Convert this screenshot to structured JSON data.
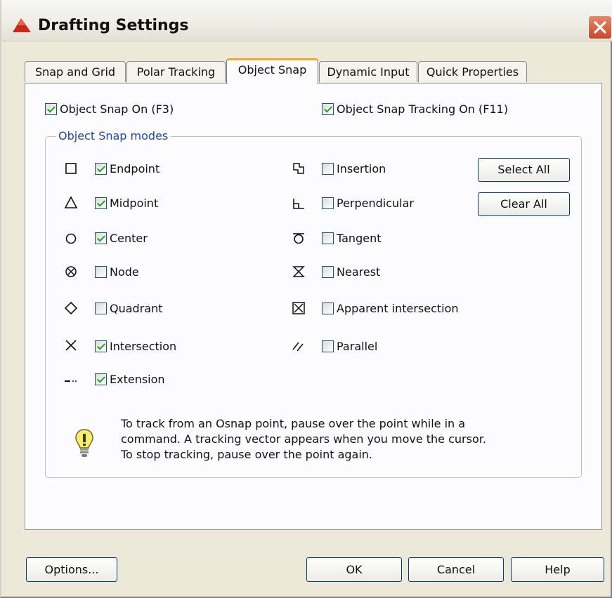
{
  "window": {
    "title": "Drafting Settings"
  },
  "tabs": [
    {
      "label": "Snap and Grid",
      "active": false
    },
    {
      "label": "Polar Tracking",
      "active": false
    },
    {
      "label": "Object Snap",
      "active": true
    },
    {
      "label": "Dynamic Input",
      "active": false
    },
    {
      "label": "Quick Properties",
      "active": false
    }
  ],
  "object_snap_on": {
    "label": "Object Snap On (F3)",
    "checked": true
  },
  "object_snap_tracking_on": {
    "label": "Object Snap Tracking On (F11)",
    "checked": true
  },
  "modes_group": {
    "label": "Object Snap modes"
  },
  "modes_left": [
    {
      "label": "Endpoint",
      "checked": true,
      "icon": "endpoint-icon"
    },
    {
      "label": "Midpoint",
      "checked": true,
      "icon": "midpoint-icon"
    },
    {
      "label": "Center",
      "checked": true,
      "icon": "center-icon"
    },
    {
      "label": "Node",
      "checked": false,
      "icon": "node-icon"
    },
    {
      "label": "Quadrant",
      "checked": false,
      "icon": "quadrant-icon"
    },
    {
      "label": "Intersection",
      "checked": true,
      "icon": "intersection-icon"
    },
    {
      "label": "Extension",
      "checked": true,
      "icon": "extension-icon"
    }
  ],
  "modes_right": [
    {
      "label": "Insertion",
      "checked": false,
      "icon": "insertion-icon"
    },
    {
      "label": "Perpendicular",
      "checked": false,
      "icon": "perpendicular-icon"
    },
    {
      "label": "Tangent",
      "checked": false,
      "icon": "tangent-icon"
    },
    {
      "label": "Nearest",
      "checked": false,
      "icon": "nearest-icon"
    },
    {
      "label": "Apparent intersection",
      "checked": false,
      "icon": "apparent-intersection-icon"
    },
    {
      "label": "Parallel",
      "checked": false,
      "icon": "parallel-icon"
    }
  ],
  "buttons": {
    "select_all": "Select All",
    "clear_all": "Clear All",
    "options": "Options...",
    "ok": "OK",
    "cancel": "Cancel",
    "help": "Help"
  },
  "tip": {
    "icon": "lightbulb-icon",
    "lines": [
      "To track from an Osnap point, pause over the point while in a",
      "command.  A tracking vector appears when you move the cursor.",
      "To stop tracking, pause over the point again."
    ]
  },
  "colors": {
    "accent_tab": "#f0a92f",
    "checkmark": "#21a121",
    "group_label": "#1f49a5",
    "close_button": "#c8472a"
  }
}
